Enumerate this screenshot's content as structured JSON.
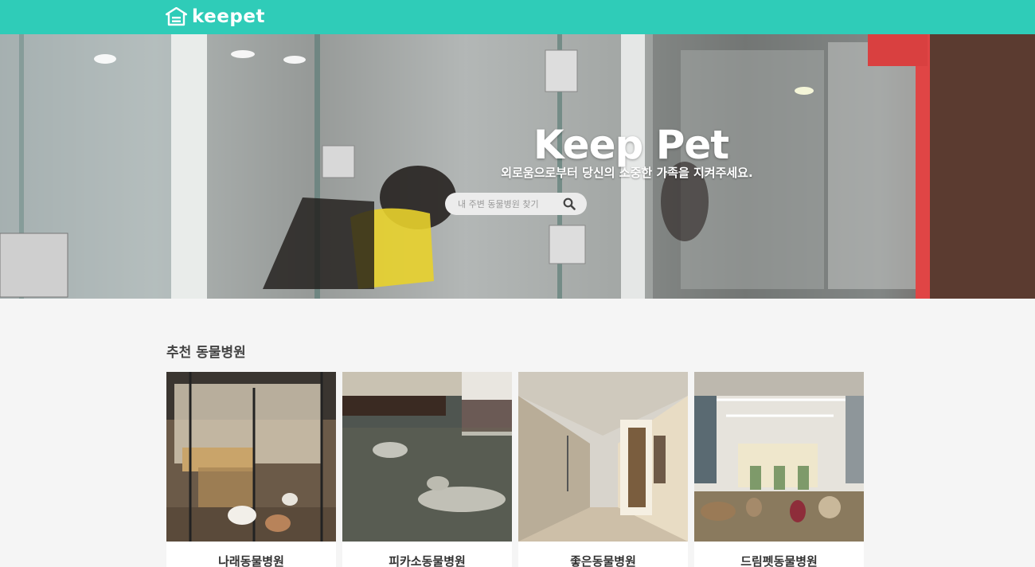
{
  "header": {
    "logo_text": "keepet",
    "logo_icon": "house-paw-icon",
    "brand_color": "#2fccb8"
  },
  "hero": {
    "title": "Keep Pet",
    "subtitle": "외로움으로부터 당신의 소중한 가족을 지켜주세요.",
    "search": {
      "placeholder": "내 주변 동물병원 찾기",
      "icon": "search-icon"
    }
  },
  "recommended": {
    "title": "추천 동물병원",
    "hospitals": [
      {
        "name": "나래동물병원"
      },
      {
        "name": "피카소동물병원"
      },
      {
        "name": "좋은동물병원"
      },
      {
        "name": "드림펫동물병원"
      }
    ]
  }
}
